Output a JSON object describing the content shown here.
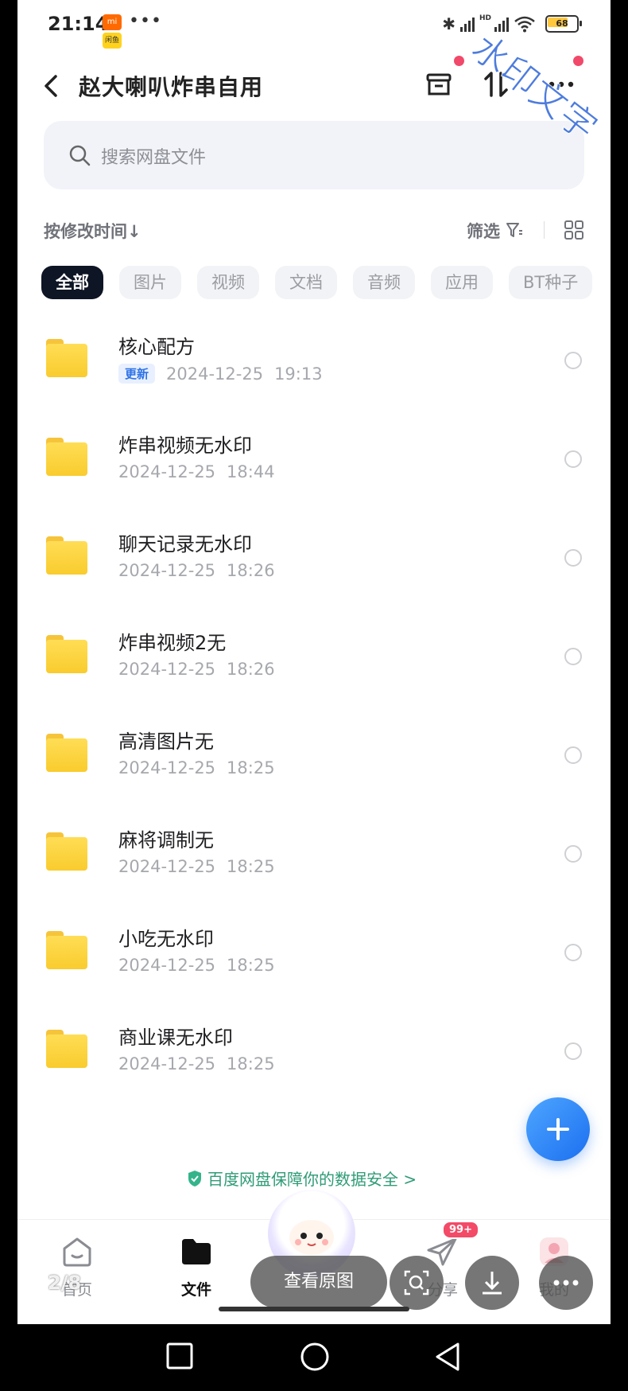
{
  "status_bar": {
    "time": "21:14",
    "mi_badge_top": "mi",
    "mi_badge_bottom": "闲鱼",
    "dots": "•••",
    "network": "HD",
    "battery": "68"
  },
  "watermark": "水印文字",
  "header": {
    "title": "赵大喇叭炸串自用"
  },
  "search": {
    "placeholder": "搜索网盘文件"
  },
  "toolbar": {
    "sort_label": "按修改时间↓",
    "filter_label": "筛选"
  },
  "chips": [
    "全部",
    "图片",
    "视频",
    "文档",
    "音频",
    "应用",
    "BT种子"
  ],
  "files": [
    {
      "name": "核心配方",
      "tag": "更新",
      "date": "2024-12-25",
      "time": "19:13"
    },
    {
      "name": "炸串视频无水印",
      "tag": "",
      "date": "2024-12-25",
      "time": "18:44"
    },
    {
      "name": "聊天记录无水印",
      "tag": "",
      "date": "2024-12-25",
      "time": "18:26"
    },
    {
      "name": "炸串视频2无",
      "tag": "",
      "date": "2024-12-25",
      "time": "18:26"
    },
    {
      "name": "高清图片无",
      "tag": "",
      "date": "2024-12-25",
      "time": "18:25"
    },
    {
      "name": "麻将调制无",
      "tag": "",
      "date": "2024-12-25",
      "time": "18:25"
    },
    {
      "name": "小吃无水印",
      "tag": "",
      "date": "2024-12-25",
      "time": "18:25"
    },
    {
      "name": "商业课无水印",
      "tag": "",
      "date": "2024-12-25",
      "time": "18:25"
    }
  ],
  "security_banner": "百度网盘保障你的数据安全 >",
  "nav": {
    "home": "首页",
    "files": "文件",
    "share": "分享",
    "share_badge": "99+",
    "me": "我的"
  },
  "viewer": {
    "page_counter": "2/8",
    "view_original": "查看原图"
  },
  "colors": {
    "accent": "#2f73e6",
    "folder": "#f9cc2e",
    "red_dot": "#f1496a",
    "secure_green": "#2f9b77"
  }
}
